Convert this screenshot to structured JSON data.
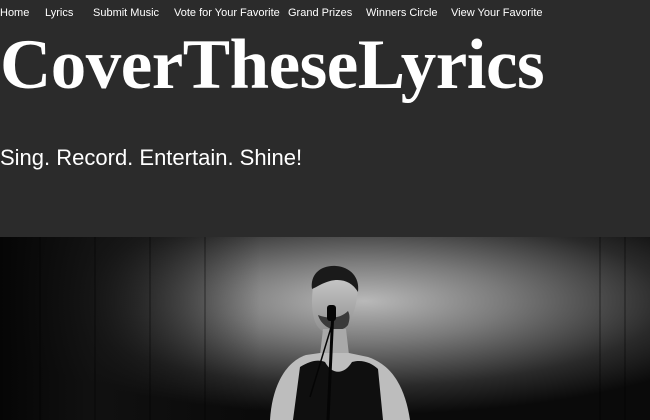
{
  "nav": {
    "items": [
      {
        "label": "Home"
      },
      {
        "label": "Lyrics"
      },
      {
        "label": "Submit Music"
      },
      {
        "label": "Vote for Your Favorite"
      },
      {
        "label": "Grand Prizes"
      },
      {
        "label": "Winners Circle"
      },
      {
        "label": "View Your Favorite"
      }
    ]
  },
  "header": {
    "title": "CoverTheseLyrics",
    "tagline": "Sing. Record. Entertain. Shine!"
  },
  "hero": {
    "image_subject": "black-and-white photo of a singer performing at a microphone on stage"
  },
  "colors": {
    "background": "#2b2b2b",
    "text": "#ffffff"
  }
}
